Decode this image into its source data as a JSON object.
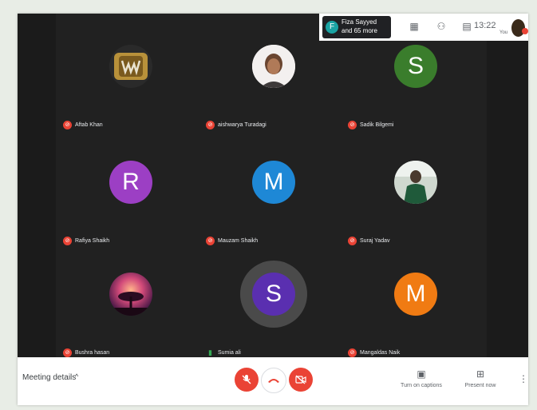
{
  "topbar": {
    "viewer_initial": "F",
    "viewer_line1": "Fiza Sayyed",
    "viewer_line2": "and 65 more",
    "icons": [
      "info-icon",
      "people-icon",
      "chat-icon"
    ],
    "time": "13:22",
    "you_label": "You"
  },
  "participants": [
    {
      "name": "Aftab Khan",
      "type": "photo",
      "photo": "championship-belt",
      "muted": true
    },
    {
      "name": "aishwarya Turadagi",
      "type": "photo",
      "photo": "portrait",
      "muted": true
    },
    {
      "name": "Sadik Bilgemi",
      "type": "initial",
      "initial": "S",
      "color": "#3a7d2c",
      "muted": true
    },
    {
      "name": "Rafiya Shaikh",
      "type": "initial",
      "initial": "R",
      "color": "#9c3fc4",
      "muted": true
    },
    {
      "name": "Mauzam Shaikh",
      "type": "initial",
      "initial": "M",
      "color": "#1e88d6",
      "muted": true
    },
    {
      "name": "Suraj Yadav",
      "type": "photo",
      "photo": "portrait-outdoor",
      "muted": true
    },
    {
      "name": "Bushra hasan",
      "type": "photo",
      "photo": "sunset-tree",
      "muted": true
    },
    {
      "name": "Sumia ali",
      "type": "initial",
      "initial": "S",
      "color": "#5a2fb0",
      "muted": false,
      "speaking": true
    },
    {
      "name": "Mangaldas Naik",
      "type": "initial",
      "initial": "M",
      "color": "#f07b13",
      "muted": true
    }
  ],
  "bottombar": {
    "meeting_details": "Meeting details",
    "captions_label": "Turn on captions",
    "present_label": "Present now"
  },
  "colors": {
    "mute_red": "#ea4335",
    "stage_bg": "#212121"
  }
}
